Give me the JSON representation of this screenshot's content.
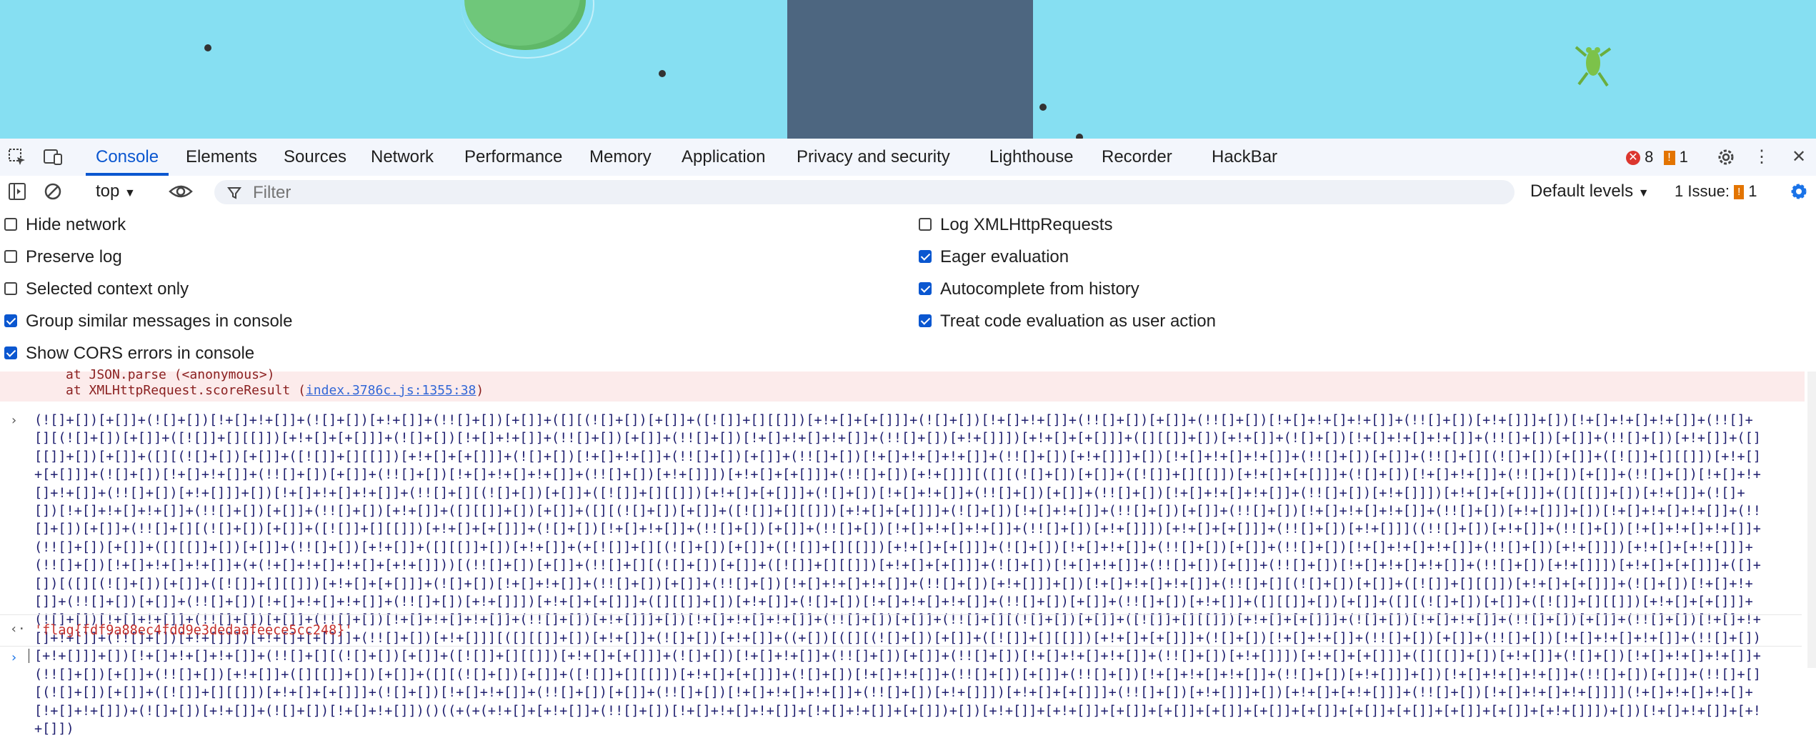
{
  "tabs": [
    "Console",
    "Elements",
    "Sources",
    "Network",
    "Performance",
    "Memory",
    "Application",
    "Privacy and security",
    "Lighthouse",
    "Recorder",
    "HackBar"
  ],
  "active_tab": "Console",
  "errors_count": "8",
  "warnings_count": "1",
  "context": "top",
  "filter_placeholder": "Filter",
  "levels": "Default levels",
  "issues_label": "1 Issue:",
  "issues_count": "1",
  "options_left": [
    {
      "label": "Hide network",
      "checked": false
    },
    {
      "label": "Preserve log",
      "checked": false
    },
    {
      "label": "Selected context only",
      "checked": false
    },
    {
      "label": "Group similar messages in console",
      "checked": true
    },
    {
      "label": "Show CORS errors in console",
      "checked": true
    }
  ],
  "options_right": [
    {
      "label": "Log XMLHttpRequests",
      "checked": false
    },
    {
      "label": "Eager evaluation",
      "checked": true
    },
    {
      "label": "Autocomplete from history",
      "checked": true
    },
    {
      "label": "Treat code evaluation as user action",
      "checked": true
    }
  ],
  "error_lines": [
    "at JSON.parse (<anonymous>)",
    "at XMLHttpRequest.scoreResult ("
  ],
  "error_link": "index.3786c.js:1355:38",
  "jsfuck": "(![]+[])[+[]]+(![]+[])[!+[]+!+[]]+(![]+[])[+!+[]]+(!![]+[])[+[]]+([][(![]+[])[+[]]+([![]]+[][[]])[+!+[]+[+[]]]+(![]+[])[!+[]+!+[]]+(!![]+[])[+[]]+(!![]+[])[!+[]+!+[]+!+[]]+(!![]+[])[+!+[]]]+[])[!+[]+!+[]+!+[]]+(!![]+[][(![]+[])[+[]]+([![]]+[][[]])[+!+[]+[+[]]]+(![]+[])[!+[]+!+[]]+(!![]+[])[+[]]+(!![]+[])[!+[]+!+[]+!+[]]+(!![]+[])[+!+[]]])[+!+[]+[+[]]]+([][[]]+[])[+!+[]]+(![]+[])[!+[]+!+[]+!+[]]+(!![]+[])[+[]]+(!![]+[])[+!+[]]+([][[]]+[])[+[]]+([][(![]+[])[+[]]+([![]]+[][[]])[+!+[]+[+[]]]+(![]+[])[!+[]+!+[]]+(!![]+[])[+[]]+(!![]+[])[!+[]+!+[]+!+[]]+(!![]+[])[+!+[]]]+[])[!+[]+!+[]+!+[]]+(!![]+[])[+[]]+(!![]+[][(![]+[])[+[]]+([![]]+[][[]])[+!+[]+[+[]]]+(![]+[])[!+[]+!+[]]+(!![]+[])[+[]]+(!![]+[])[!+[]+!+[]+!+[]]+(!![]+[])[+!+[]]])[+!+[]+[+[]]]+(!![]+[])[+!+[]]][([][(![]+[])[+[]]+([![]]+[][[]])[+!+[]+[+[]]]+(![]+[])[!+[]+!+[]]+(!![]+[])[+[]]+(!![]+[])[!+[]+!+[]+!+[]]+(!![]+[])[+!+[]]]+[])[!+[]+!+[]+!+[]]+(!![]+[][(![]+[])[+[]]+([![]]+[][[]])[+!+[]+[+[]]]+(![]+[])[!+[]+!+[]]+(!![]+[])[+[]]+(!![]+[])[!+[]+!+[]+!+[]]+(!![]+[])[+!+[]]])[+!+[]+[+[]]]+([][[]]+[])[+!+[]]+(![]+[])[!+[]+!+[]+!+[]]+(!![]+[])[+[]]+(!![]+[])[+!+[]]+([][[]]+[])[+[]]+([][(![]+[])[+[]]+([![]]+[][[]])[+!+[]+[+[]]]+(![]+[])[!+[]+!+[]]+(!![]+[])[+[]]+(!![]+[])[!+[]+!+[]+!+[]]+(!![]+[])[+!+[]]]+[])[!+[]+!+[]+!+[]]+(!![]+[])[+[]]+(!![]+[][(![]+[])[+[]]+([![]]+[][[]])[+!+[]+[+[]]]+(![]+[])[!+[]+!+[]]+(!![]+[])[+[]]+(!![]+[])[!+[]+!+[]+!+[]]+(!![]+[])[+!+[]]])[+!+[]+[+[]]]+(!![]+[])[+!+[]]]((!![]+[])[+!+[]]+(!![]+[])[!+[]+!+[]+!+[]]+(!![]+[])[+[]]+([][[]]+[])[+[]]+(!![]+[])[+!+[]]+([][[]]+[])[+!+[]]+(+[![]]+[][(![]+[])[+[]]+([![]]+[][[]])[+!+[]+[+[]]]+(![]+[])[!+[]+!+[]]+(!![]+[])[+[]]+(!![]+[])[!+[]+!+[]+!+[]]+(!![]+[])[+!+[]]])[+!+[]+[+!+[]]]+(!![]+[])[!+[]+!+[]+!+[]]+(+(!+[]+!+[]+!+[]+[+!+[]]))[(!![]+[])[+[]]+(!![]+[][(![]+[])[+[]]+([![]]+[][[]])[+!+[]+[+[]]]+(![]+[])[!+[]+!+[]]+(!![]+[])[+[]]+(!![]+[])[!+[]+!+[]+!+[]]+(!![]+[])[+!+[]]])[+!+[]+[+[]]]+([]+[])[([][(![]+[])[+[]]+([![]]+[][[]])[+!+[]+[+[]]]+(![]+[])[!+[]+!+[]]+(!![]+[])[+[]]+(!![]+[])[!+[]+!+[]+!+[]]+(!![]+[])[+!+[]]]+[])[!+[]+!+[]+!+[]]+(!![]+[][(![]+[])[+[]]+([![]]+[][[]])[+!+[]+[+[]]]+(![]+[])[!+[]+!+[]]+(!![]+[])[+[]]+(!![]+[])[!+[]+!+[]+!+[]]+(!![]+[])[+!+[]]])[+!+[]+[+[]]]+([][[]]+[])[+!+[]]+(![]+[])[!+[]+!+[]+!+[]]+(!![]+[])[+[]]+(!![]+[])[+!+[]]+([][[]]+[])[+[]]+([][(![]+[])[+[]]+([![]]+[][[]])[+!+[]+[+[]]]+(![]+[])[!+[]+!+[]]+(!![]+[])[+[]]+(!![]+[])[!+[]+!+[]+!+[]]+(!![]+[])[+!+[]]]+[])[!+[]+!+[]+!+[]]+(!![]+[])[+[]]+(!![]+[][(![]+[])[+[]]+([![]]+[][[]])[+!+[]+[+[]]]+(![]+[])[!+[]+!+[]]+(!![]+[])[+[]]+(!![]+[])[!+[]+!+[]+!+[]]+(!![]+[])[+!+[]]])[+!+[]+[+[]]]+(!![]+[])[+!+[]]][([][[]]+[])[+!+[]]+(![]+[])[+!+[]]+((+[])[([][(![]+[])[+[]]+([![]]+[][[]])[+!+[]+[+[]]]+(![]+[])[!+[]+!+[]]+(!![]+[])[+[]]+(!![]+[])[!+[]+!+[]+!+[]]+(!![]+[])[+!+[]]]+[])[!+[]+!+[]+!+[]]+(!![]+[][(![]+[])[+[]]+([![]]+[][[]])[+!+[]+[+[]]]+(![]+[])[!+[]+!+[]]+(!![]+[])[+[]]+(!![]+[])[!+[]+!+[]+!+[]]+(!![]+[])[+!+[]]])[+!+[]+[+[]]]+([][[]]+[])[+!+[]]+(![]+[])[!+[]+!+[]+!+[]]+(!![]+[])[+[]]+(!![]+[])[+!+[]]+([][[]]+[])[+[]]+([][(![]+[])[+[]]+([![]]+[][[]])[+!+[]+[+[]]]+(![]+[])[!+[]+!+[]]+(!![]+[])[+[]]+(!![]+[])[!+[]+!+[]+!+[]]+(!![]+[])[+!+[]]]+[])[!+[]+!+[]+!+[]]+(!![]+[])[+[]]+(!![]+[][(![]+[])[+[]]+([![]]+[][[]])[+!+[]+[+[]]]+(![]+[])[!+[]+!+[]]+(!![]+[])[+[]]+(!![]+[])[!+[]+!+[]+!+[]]+(!![]+[])[+!+[]]])[+!+[]+[+[]]]+(!![]+[])[+!+[]]]+[])[+!+[]+[+!+[]]]+(!![]+[])[!+[]+!+[]+!+[]]]](!+[]+!+[]+!+[]+[!+[]+!+[]])+(![]+[])[+!+[]]+(![]+[])[!+[]+!+[]])()((+(+(+!+[]+[+!+[]]+(!![]+[])[!+[]+!+[]+!+[]]+[!+[]+!+[]]+[+[]])+[])[+!+[]]+[+!+[]]+[+[]]+[+[]]+[+[]]+[+[]]+[+[]]+[+[]]+[+[]]+[+[]]+[+[]]+[+!+[]]])+[])[!+[]+!+[]]+[+!+[]])",
  "result": "'flag{fdf9a88ec4fdd9e3dedaafeece5cc248}'"
}
